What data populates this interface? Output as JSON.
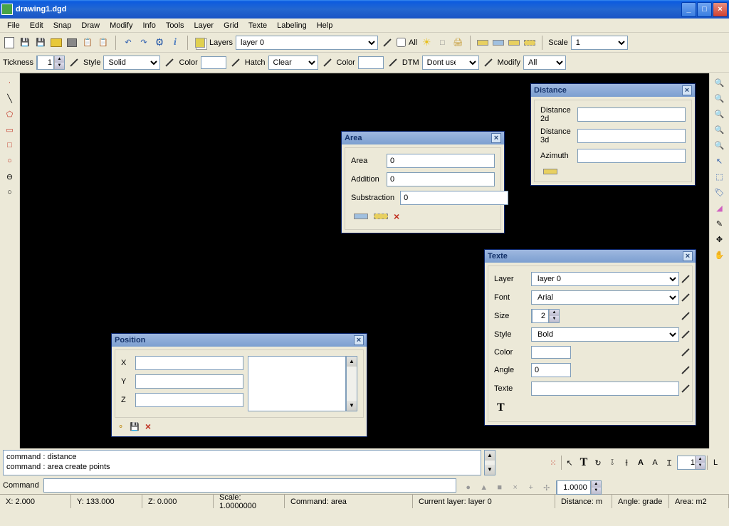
{
  "window": {
    "title": "drawing1.dgd"
  },
  "menu": [
    "File",
    "Edit",
    "Snap",
    "Draw",
    "Modify",
    "Info",
    "Tools",
    "Layer",
    "Grid",
    "Texte",
    "Labeling",
    "Help"
  ],
  "toolbar1": {
    "layers_label": "Layers",
    "layer_selected": "layer 0",
    "all_label": "All",
    "scale_label": "Scale",
    "scale_value": "1"
  },
  "toolbar2": {
    "thickness_label": "Tickness",
    "thickness_value": "1",
    "style_label": "Style",
    "style_value": "Solid",
    "color_label": "Color",
    "hatch_label": "Hatch",
    "hatch_value": "Clear",
    "color2_label": "Color",
    "dtm_label": "DTM",
    "dtm_value": "Dont use Z",
    "modify_label": "Modify",
    "modify_value": "All"
  },
  "panel_distance": {
    "title": "Distance",
    "d2d_label": "Distance 2d",
    "d3d_label": "Distance 3d",
    "az_label": "Azimuth",
    "d2d": "",
    "d3d": "",
    "az": ""
  },
  "panel_area": {
    "title": "Area",
    "area_label": "Area",
    "add_label": "Addition",
    "sub_label": "Substraction",
    "area": "0",
    "add": "0",
    "sub": "0"
  },
  "panel_position": {
    "title": "Position",
    "x_label": "X",
    "y_label": "Y",
    "z_label": "Z",
    "x": "",
    "y": "",
    "z": ""
  },
  "panel_texte": {
    "title": "Texte",
    "layer_label": "Layer",
    "layer": "layer 0",
    "font_label": "Font",
    "font": "Arial",
    "size_label": "Size",
    "size": "2",
    "style_label": "Style",
    "style": "Bold",
    "color_label": "Color",
    "angle_label": "Angle",
    "angle": "0",
    "texte_label": "Texte",
    "texte": ""
  },
  "history": "command : distance\ncommand : area   create points",
  "command_label": "Command",
  "command_value": "",
  "right_toolbar": {
    "num_value": "1",
    "coord_value": "1.0000"
  },
  "status": {
    "x": "X: 2.000",
    "y": "Y: 133.000",
    "z": "Z: 0.000",
    "scale": "Scale: 1.0000000",
    "cmd": "Command: area",
    "layer": "Current layer: layer 0",
    "dist": "Distance: m",
    "angle": "Angle: grade",
    "area": "Area: m2"
  }
}
